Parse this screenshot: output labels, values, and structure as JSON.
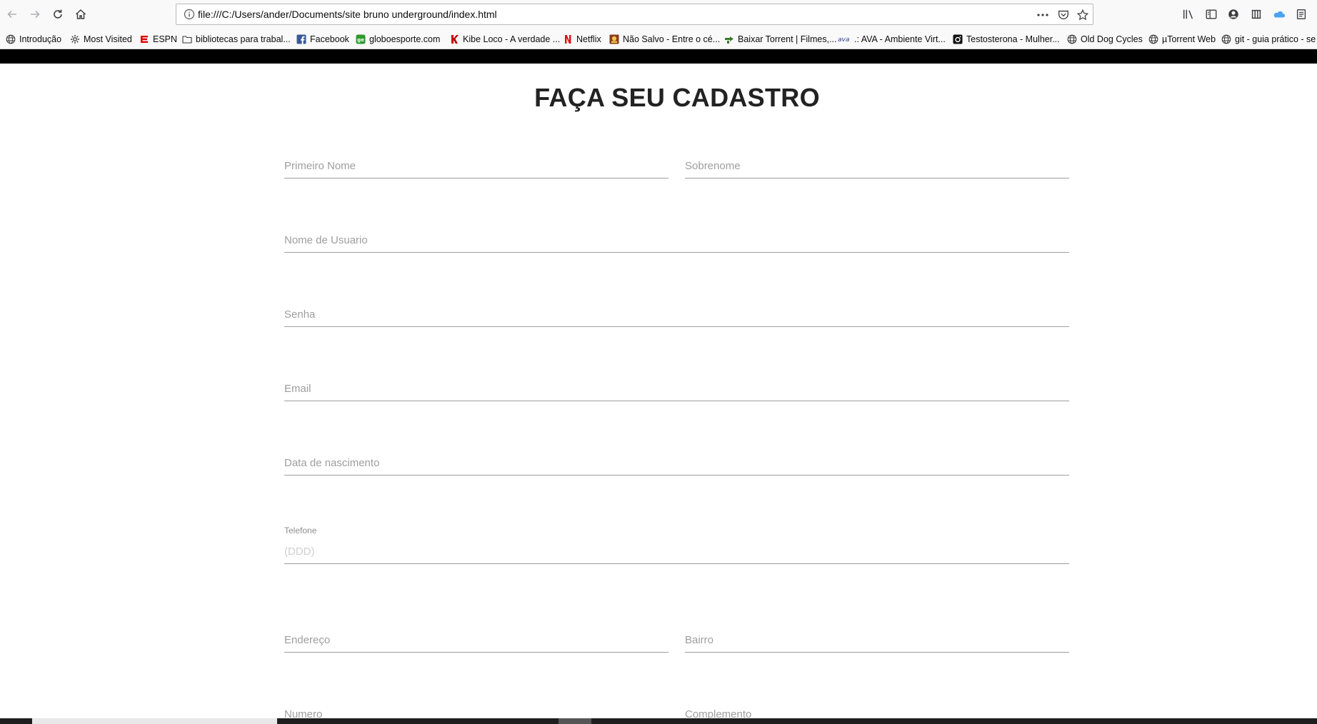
{
  "browser": {
    "url": "file:///C:/Users/ander/Documents/site bruno underground/index.html",
    "nav_icons": [
      "back-icon",
      "forward-icon",
      "reload-icon",
      "home-icon"
    ],
    "url_actions": [
      "more-icon",
      "pocket-icon",
      "bookmark-star-icon"
    ],
    "toolbar_icons": [
      "library-icon",
      "sidebar-icon",
      "account-icon",
      "extension-icon",
      "onedrive-icon",
      "notes-icon"
    ]
  },
  "bookmarks": [
    {
      "label": "Introdução",
      "icon": "globe-icon"
    },
    {
      "label": "Most Visited",
      "icon": "gear-icon"
    },
    {
      "label": "ESPN",
      "icon": "espn-icon"
    },
    {
      "label": "bibliotecas para trabal...",
      "icon": "folder-icon"
    },
    {
      "label": "Facebook",
      "icon": "facebook-icon"
    },
    {
      "label": "globoesporte.com",
      "icon": "ge-icon"
    },
    {
      "label": "Kibe Loco - A verdade ...",
      "icon": "kibe-icon"
    },
    {
      "label": "Netflix",
      "icon": "netflix-icon"
    },
    {
      "label": "Não Salvo - Entre o cé...",
      "icon": "naosalvo-icon"
    },
    {
      "label": "Baixar Torrent | Filmes,...",
      "icon": "torrent-icon"
    },
    {
      "label": ".: AVA - Ambiente Virt...",
      "icon": "ava-icon"
    },
    {
      "label": "Testosterona - Mulher...",
      "icon": "camera-icon"
    },
    {
      "label": "Old Dog Cycles",
      "icon": "globe-icon"
    },
    {
      "label": "µTorrent Web",
      "icon": "globe-icon"
    },
    {
      "label": "git - guia prático - se",
      "icon": "globe-icon"
    }
  ],
  "page": {
    "title": "FAÇA SEU CADASTRO",
    "fields": {
      "first_name": "Primeiro Nome",
      "last_name": "Sobrenome",
      "username": "Nome de Usuario",
      "password": "Senha",
      "email": "Email",
      "birthdate": "Data de nascimento",
      "phone_label": "Telefone",
      "phone_placeholder": "(DDD)",
      "address": "Endereço",
      "neighborhood": "Bairro",
      "number": "Numero",
      "complement": "Complemento"
    }
  },
  "colors": {
    "input_line": "#9e9e9e",
    "placeholder": "#9e9e9e",
    "header_bar": "#000000"
  }
}
